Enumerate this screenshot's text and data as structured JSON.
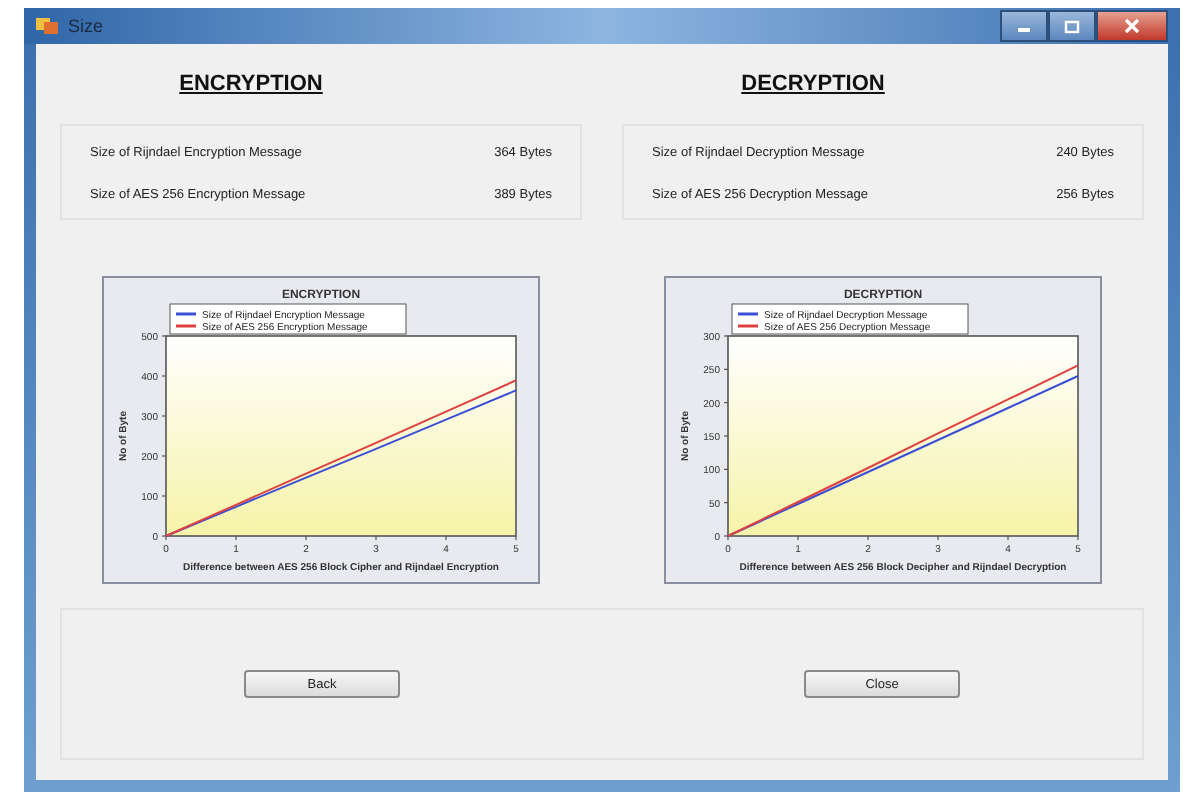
{
  "window": {
    "title": "Size"
  },
  "sections": [
    {
      "heading": "ENCRYPTION",
      "rows": [
        {
          "label": "Size of Rijndael Encryption Message",
          "value": "364 Bytes"
        },
        {
          "label": "Size of AES 256 Encryption Message",
          "value": "389 Bytes"
        }
      ],
      "chart_data": {
        "type": "line",
        "legend": "top-left",
        "title": "ENCRYPTION",
        "xlabel": "Difference between AES 256 Block Cipher and Rijndael Encryption",
        "ylabel": "No of Byte",
        "x": [
          0,
          1,
          2,
          3,
          4,
          5
        ],
        "xlim": [
          0,
          5
        ],
        "ylim": [
          0,
          500
        ],
        "xticks": [
          0,
          1,
          2,
          3,
          4,
          5
        ],
        "yticks": [
          0,
          100,
          200,
          300,
          400,
          500
        ],
        "series": [
          {
            "name": "Size of Rijndael Encryption Message",
            "color": "#3b4fd6",
            "values": [
              0,
              73,
              146,
              218,
              291,
              364
            ]
          },
          {
            "name": "Size of AES 256 Encryption Message",
            "color": "#e04040",
            "values": [
              0,
              78,
              156,
              233,
              311,
              389
            ]
          }
        ]
      },
      "button": "Back"
    },
    {
      "heading": "DECRYPTION",
      "rows": [
        {
          "label": "Size of Rijndael Decryption Message",
          "value": "240 Bytes"
        },
        {
          "label": "Size of AES 256 Decryption Message",
          "value": "256 Bytes"
        }
      ],
      "chart_data": {
        "type": "line",
        "legend": "top-left",
        "title": "DECRYPTION",
        "xlabel": "Difference between AES 256 Block Decipher and Rijndael Decryption",
        "ylabel": "No of Byte",
        "x": [
          0,
          1,
          2,
          3,
          4,
          5
        ],
        "xlim": [
          0,
          5
        ],
        "ylim": [
          0,
          300
        ],
        "xticks": [
          0,
          1,
          2,
          3,
          4,
          5
        ],
        "yticks": [
          0,
          50,
          100,
          150,
          200,
          250,
          300
        ],
        "series": [
          {
            "name": "Size of Rijndael Decryption Message",
            "color": "#3b4fd6",
            "values": [
              0,
              48,
              96,
              144,
              192,
              240
            ]
          },
          {
            "name": "Size of AES 256 Decryption Message",
            "color": "#e04040",
            "values": [
              0,
              51,
              102,
              154,
              205,
              256
            ]
          }
        ]
      },
      "button": "Close"
    }
  ]
}
